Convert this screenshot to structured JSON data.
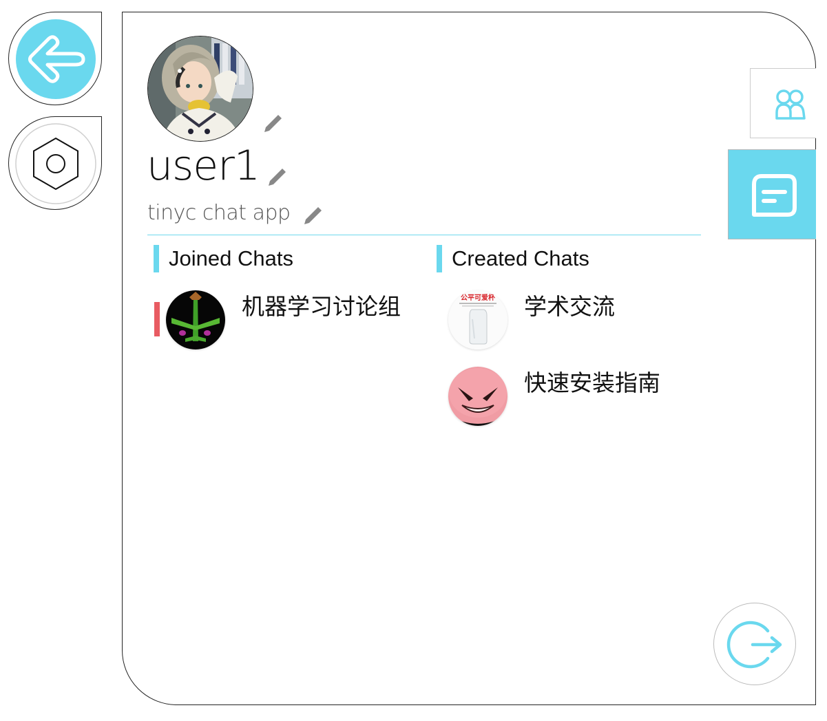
{
  "profile": {
    "username": "user1",
    "tagline": "tinyc chat app"
  },
  "sections": {
    "joined_label": "Joined Chats",
    "created_label": "Created Chats"
  },
  "joined_chats": [
    {
      "name": "机器学习讨论组",
      "unread": true
    }
  ],
  "created_chats": [
    {
      "name": "学术交流",
      "avatar_caption": "公平可爱杯"
    },
    {
      "name": "快速安装指南"
    }
  ],
  "icons": {
    "back": "arrow-left-icon",
    "settings": "hexagon-settings-icon",
    "members": "users-icon",
    "chats": "chat-bubble-icon",
    "logout": "logout-icon",
    "edit": "pencil-icon"
  },
  "colors": {
    "accent": "#6ad8ee",
    "unread": "#e85b62",
    "border": "#222222"
  }
}
